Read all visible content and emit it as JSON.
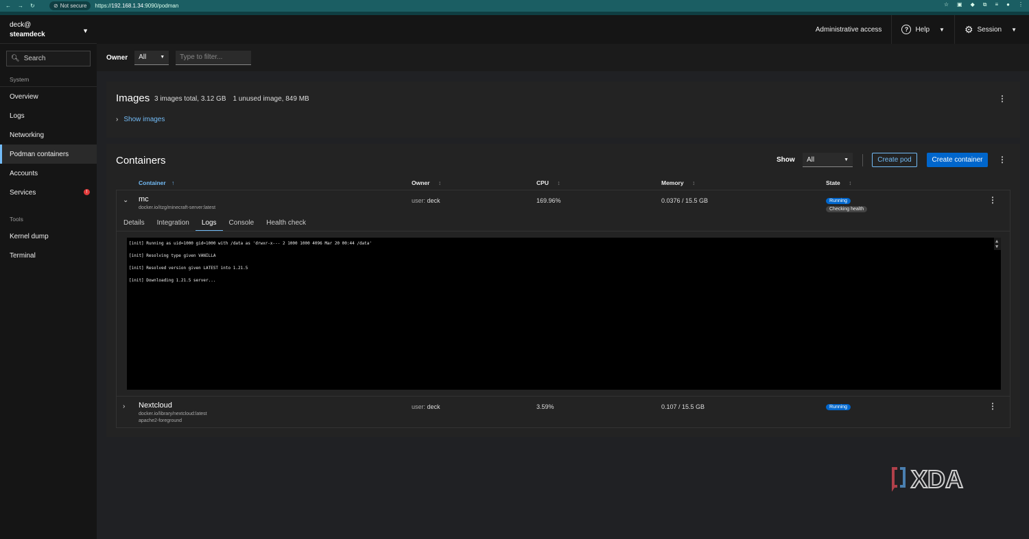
{
  "browser": {
    "security": "Not secure",
    "url_scheme": "https://",
    "url_host": "192.168.1.34",
    "url_rest": ":9090/podman"
  },
  "sidebar": {
    "user": "deck@",
    "host": "steamdeck",
    "search_placeholder": "Search",
    "groups": [
      {
        "label": "System",
        "items": [
          "Overview",
          "Logs",
          "Networking",
          "Podman containers",
          "Accounts",
          "Services"
        ]
      },
      {
        "label": "Tools",
        "items": [
          "Kernel dump",
          "Terminal"
        ]
      }
    ],
    "services_badge": "!"
  },
  "topbar": {
    "admin": "Administrative access",
    "help": "Help",
    "session": "Session"
  },
  "filter": {
    "owner_label": "Owner",
    "owner_value": "All",
    "filter_placeholder": "Type to filter..."
  },
  "images": {
    "title": "Images",
    "total": "3 images total, 3.12 GB",
    "unused": "1 unused image, 849 MB",
    "show_link": "Show images"
  },
  "containers": {
    "title": "Containers",
    "show_label": "Show",
    "show_value": "All",
    "create_pod": "Create pod",
    "create_container": "Create container",
    "columns": [
      "Container",
      "Owner",
      "CPU",
      "Memory",
      "State"
    ],
    "rows": [
      {
        "name": "mc",
        "image": "docker.io/itzg/minecraft-server:latest",
        "owner_prefix": "user:",
        "owner": "deck",
        "cpu": "169.96%",
        "memory": "0.0376 / 15.5 GB",
        "state": "Running",
        "health": "Checking health",
        "tabs": [
          "Details",
          "Integration",
          "Logs",
          "Console",
          "Health check"
        ],
        "logs": [
          "[init] Running as uid=1000 gid=1000 with /data as 'drwxr-x--- 2 1000 1000 4096 Mar 20 00:44 /data'",
          "[init] Resolving type given VANILLA",
          "[init] Resolved version given LATEST into 1.21.5",
          "[init] Downloading 1.21.5 server..."
        ]
      },
      {
        "name": "Nextcloud",
        "image": "docker.io/library/nextcloud:latest",
        "command": "apache2-foreground",
        "owner_prefix": "user:",
        "owner": "deck",
        "cpu": "3.59%",
        "memory": "0.107 / 15.5 GB",
        "state": "Running"
      }
    ]
  },
  "watermark": "XDA",
  "colors": {
    "accent": "#73bcf7",
    "primary": "#0066cc",
    "browser": "#1b5e63"
  }
}
